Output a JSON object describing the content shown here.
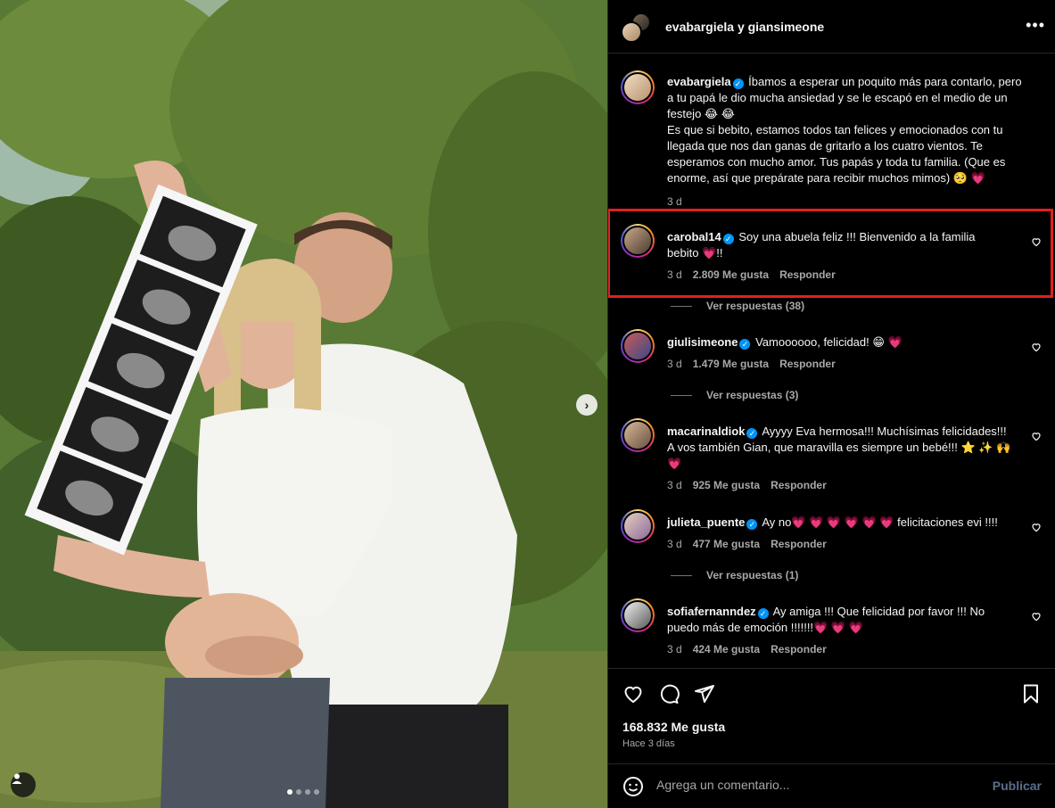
{
  "header": {
    "names": "evabargiela y giansimeone",
    "more_icon": "more-horizontal-icon"
  },
  "caption": {
    "username": "evabargiela",
    "text_1": " Íbamos a esperar un poquito más para contarlo, pero a tu papá le dio mucha ansiedad y se le escapó en el medio de un festejo 😂 😂",
    "text_2": "Es que si bebito, estamos todos tan felices y emocionados con tu llegada que nos dan ganas de gritarlo a los cuatro vientos. Te esperamos con mucho amor. Tus papás y toda tu familia. (Que es enorme, así que prepárate para recibir muchos mimos) 🥺 💗",
    "time": "3 d"
  },
  "comments": [
    {
      "username": "carobal14",
      "text": " Soy una abuela feliz !!! Bienvenido a la familia bebito 💗!!",
      "time": "3 d",
      "likes": "2.809 Me gusta",
      "reply": "Responder",
      "view_replies": "Ver respuestas (38)",
      "highlighted": true
    },
    {
      "username": "giulisimeone",
      "text": " Vamoooooo, felicidad! 😁 💗",
      "time": "3 d",
      "likes": "1.479 Me gusta",
      "reply": "Responder",
      "view_replies": "Ver respuestas (3)"
    },
    {
      "username": "macarinaldiok",
      "text": " Ayyyy Eva hermosa!!! Muchísimas felicidades!!! A vos también Gian, que maravilla es siempre un bebé!!! ⭐ ✨ 🙌 💗",
      "time": "3 d",
      "likes": "925 Me gusta",
      "reply": "Responder"
    },
    {
      "username": "julieta_puente",
      "text": " Ay no💗 💗 💗 💗 💗 💗 felicitaciones evi !!!!",
      "time": "3 d",
      "likes": "477 Me gusta",
      "reply": "Responder",
      "view_replies": "Ver respuestas (1)"
    },
    {
      "username": "sofiafernanndez",
      "text": " Ay amiga !!! Que felicidad por favor !!! No puedo más de emoción !!!!!!!💗 💗 💗",
      "time": "3 d",
      "likes": "424 Me gusta",
      "reply": "Responder"
    }
  ],
  "actions": {
    "likes": "168.832 Me gusta",
    "when": "Hace 3 días"
  },
  "add_comment": {
    "placeholder": "Agrega un comentario...",
    "post_label": "Publicar"
  },
  "colors": {
    "highlight": "#e0201f",
    "verified": "#0095f6",
    "post_disabled": "#5a6e8a"
  }
}
